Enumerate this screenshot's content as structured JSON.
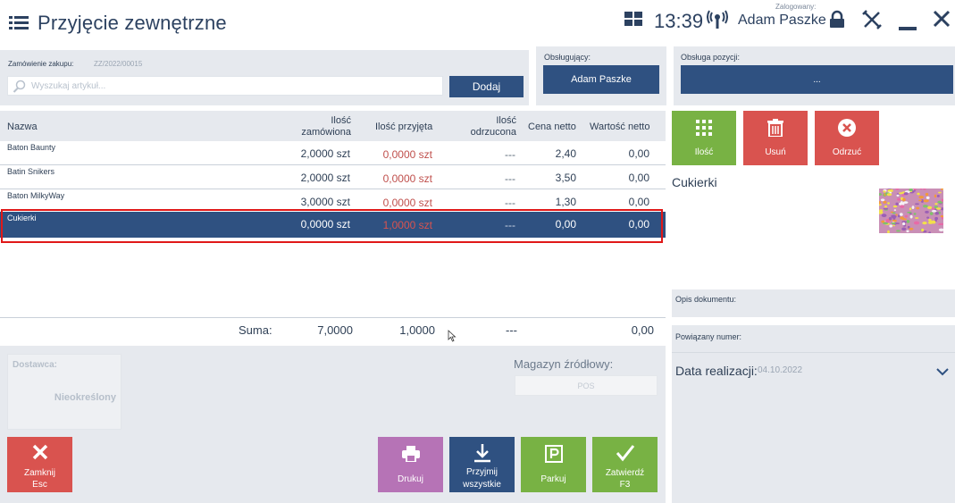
{
  "header": {
    "title": "Przyjęcie zewnętrzne",
    "time": "13:39",
    "logged_caption": "Zalogowany:",
    "user": "Adam Paszke"
  },
  "order": {
    "label": "Zamówienie zakupu:",
    "number": "ZZ/2022/00015",
    "search_placeholder": "Wyszukaj artykuł...",
    "add_label": "Dodaj"
  },
  "operator": {
    "label": "Obsługujący:",
    "value": "Adam Paszke"
  },
  "position_handling": {
    "label": "Obsługa pozycji:",
    "value": "..."
  },
  "table": {
    "columns": {
      "name": "Nazwa",
      "ordered_l1": "Ilość",
      "ordered_l2": "zamówiona",
      "received": "Ilość przyjęta",
      "rejected_l1": "Ilość",
      "rejected_l2": "odrzucona",
      "net_price": "Cena netto",
      "net_value": "Wartość netto"
    },
    "rows": [
      {
        "name": "Baton Baunty",
        "ordered": "2,0000 szt",
        "received": "0,0000 szt",
        "rejected": "---",
        "price": "2,40",
        "value": "0,00"
      },
      {
        "name": "Batin Snikers",
        "ordered": "2,0000 szt",
        "received": "0,0000 szt",
        "rejected": "---",
        "price": "3,50",
        "value": "0,00"
      },
      {
        "name": "Baton MilkyWay",
        "ordered": "3,0000 szt",
        "received": "0,0000 szt",
        "rejected": "---",
        "price": "1,30",
        "value": "0,00"
      },
      {
        "name": "Cukierki",
        "ordered": "0,0000 szt",
        "received": "1,0000 szt",
        "rejected": "---",
        "price": "0,00",
        "value": "0,00",
        "selected": true
      }
    ],
    "sum": {
      "label": "Suma:",
      "ordered": "7,0000",
      "received": "1,0000",
      "rejected": "---",
      "value": "0,00"
    }
  },
  "supplier": {
    "label": "Dostawca:",
    "value": "Nieokreślony"
  },
  "warehouse": {
    "label": "Magazyn źródłowy:",
    "value": "POS"
  },
  "actions": {
    "close_l1": "Zamknij",
    "close_l2": "Esc",
    "print": "Drukuj",
    "accept_all_l1": "Przyjmij",
    "accept_all_l2": "wszystkie",
    "park": "Parkuj",
    "confirm_l1": "Zatwierdź",
    "confirm_l2": "F3"
  },
  "side": {
    "qty": "Ilość",
    "delete": "Usuń",
    "reject": "Odrzuć",
    "product_name": "Cukierki",
    "doc_desc_label": "Opis dokumentu:",
    "related_label": "Powiązany numer:",
    "date_label": "Data realizacji:",
    "date_value": "04.10.2022"
  },
  "icons": {
    "menu": "menu-icon",
    "grid": "grid-icon",
    "signal": "signal-icon",
    "lock": "lock-icon",
    "tools": "tools-icon",
    "minimize": "minimize-icon",
    "close": "close-icon",
    "search": "search-icon",
    "chevron": "chevron-down-icon"
  },
  "colors": {
    "primary": "#2f5181",
    "green": "#78b244",
    "red": "#d9534f",
    "purple": "#b673b6",
    "panel": "#e6e9ee",
    "highlight_outline": "#e01818"
  }
}
